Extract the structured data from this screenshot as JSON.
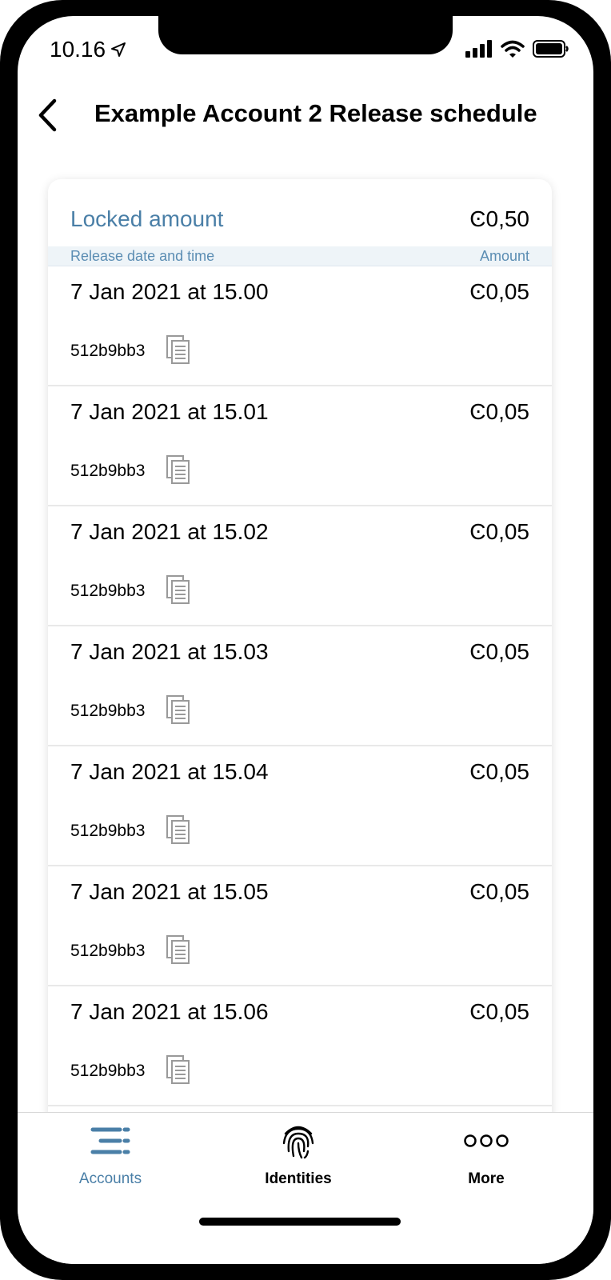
{
  "status_bar": {
    "time": "10.16"
  },
  "header": {
    "title": "Example Account 2 Release schedule"
  },
  "schedule": {
    "locked_label": "Locked amount",
    "locked_amount": "Ͼ0,50",
    "col_date": "Release date and time",
    "col_amount": "Amount",
    "rows": [
      {
        "date": "7 Jan 2021 at 15.00",
        "amount": "Ͼ0,05",
        "hash": "512b9bb3"
      },
      {
        "date": "7 Jan 2021 at 15.01",
        "amount": "Ͼ0,05",
        "hash": "512b9bb3"
      },
      {
        "date": "7 Jan 2021 at 15.02",
        "amount": "Ͼ0,05",
        "hash": "512b9bb3"
      },
      {
        "date": "7 Jan 2021 at 15.03",
        "amount": "Ͼ0,05",
        "hash": "512b9bb3"
      },
      {
        "date": "7 Jan 2021 at 15.04",
        "amount": "Ͼ0,05",
        "hash": "512b9bb3"
      },
      {
        "date": "7 Jan 2021 at 15.05",
        "amount": "Ͼ0,05",
        "hash": "512b9bb3"
      },
      {
        "date": "7 Jan 2021 at 15.06",
        "amount": "Ͼ0,05",
        "hash": "512b9bb3"
      }
    ]
  },
  "tabbar": {
    "accounts": {
      "label": "Accounts",
      "icon": "accounts-list-icon",
      "active": true
    },
    "identities": {
      "label": "Identities",
      "icon": "fingerprint-icon"
    },
    "more": {
      "label": "More",
      "icon": "more-dots-icon"
    }
  },
  "colors": {
    "accent": "#4a7fa7",
    "header_band": "#eef4f8",
    "icon_gray": "#9a9a9a"
  },
  "icons": {
    "back": "chevron-left-icon",
    "copy": "copy-icon",
    "location": "location-arrow-icon",
    "signal": "cellular-signal-icon",
    "wifi": "wifi-icon",
    "battery": "battery-icon"
  }
}
